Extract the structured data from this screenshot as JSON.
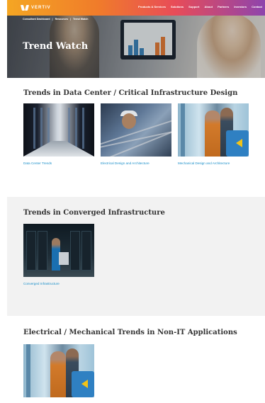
{
  "colors": {
    "link": "#1b8fc9",
    "nav_gradient": [
      "#f5a623",
      "#f07c2a",
      "#e84c58",
      "#8e44ad"
    ],
    "section_gray": "#f2f2f2"
  },
  "header": {
    "logo_text": "VERTIV",
    "logo_icon": "vertiv-logo-icon",
    "nav": [
      "Products & Services",
      "Solutions",
      "Support",
      "About",
      "Partners",
      "Investors",
      "Contact"
    ]
  },
  "hero": {
    "breadcrumb": [
      "Consultant Dashboard",
      "Resources",
      "Trend Watch"
    ],
    "title": "Trend Watch"
  },
  "sections": [
    {
      "title": "Trends in Data Center / Critical Infrastructure Design",
      "cards": [
        {
          "caption": "Data Center Trends"
        },
        {
          "caption": "Electrical Design and Architecture"
        },
        {
          "caption": "Mechanical Design and Architecture"
        }
      ]
    },
    {
      "title": "Trends in Converged Infrastructure",
      "cards": [
        {
          "caption": "Converged Infrastructure"
        }
      ]
    },
    {
      "title": "Electrical / Mechanical Trends in Non-IT Applications",
      "cards": [
        {
          "caption": ""
        }
      ]
    }
  ]
}
